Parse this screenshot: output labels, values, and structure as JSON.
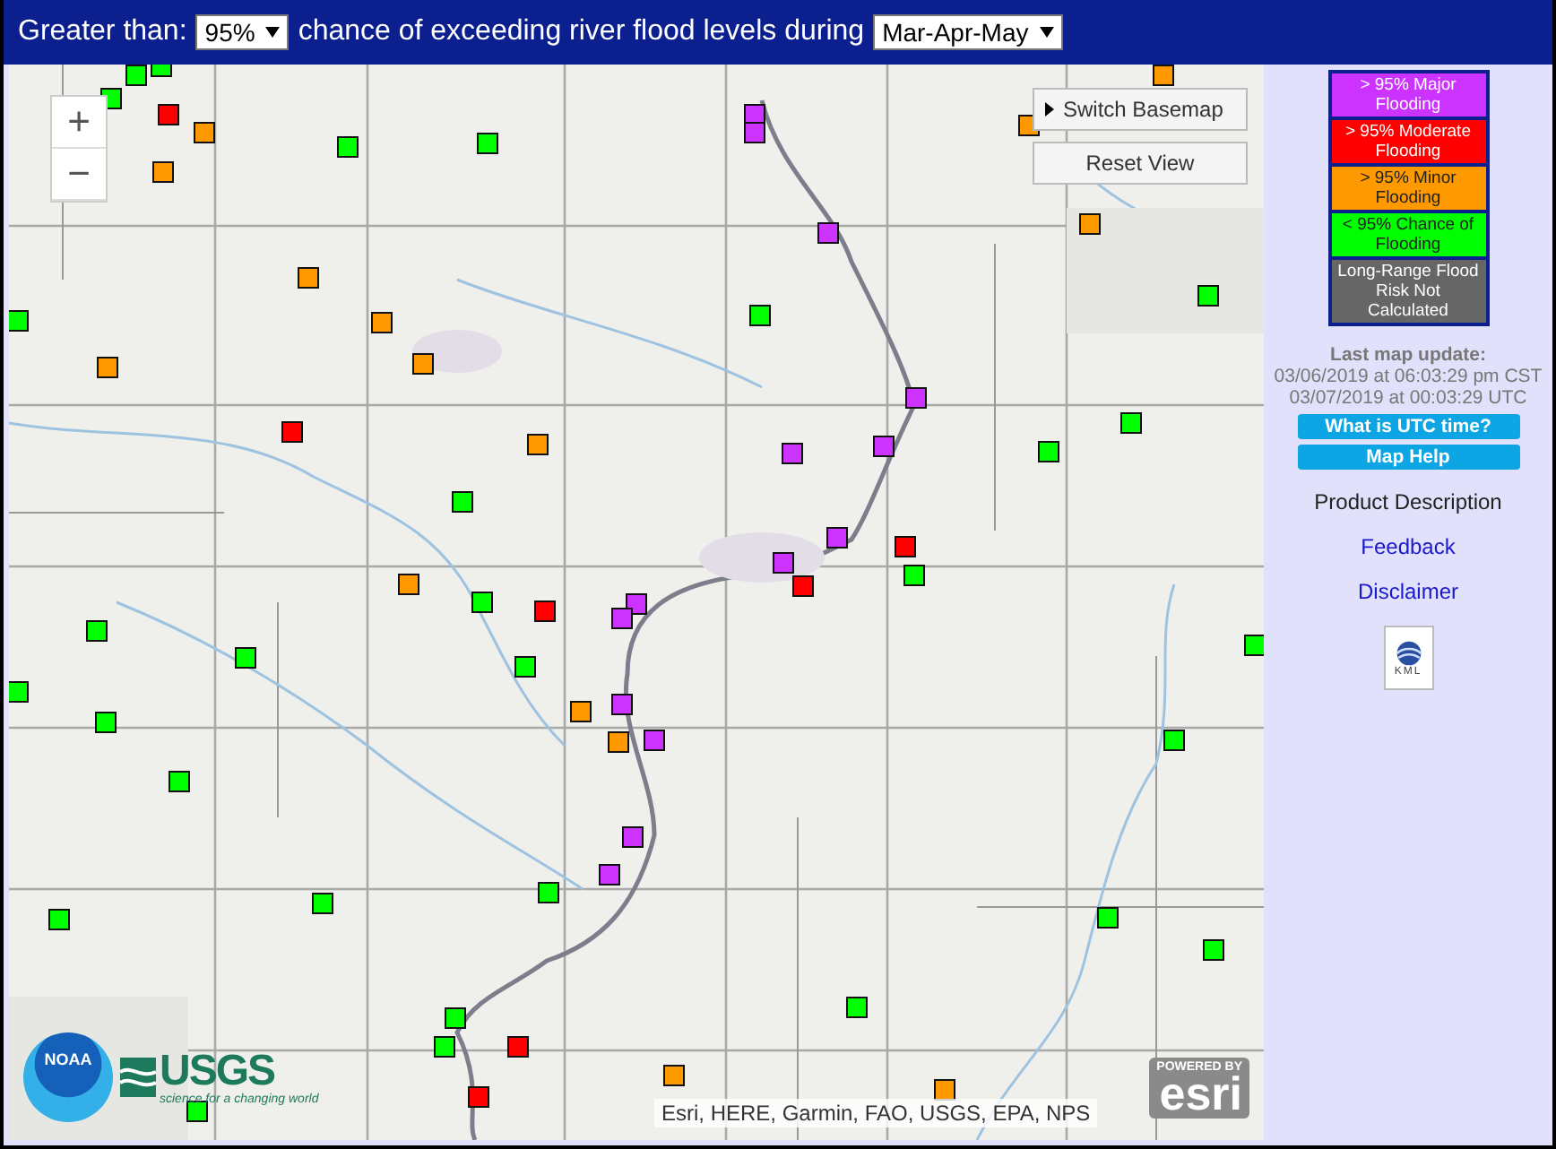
{
  "header": {
    "label_before": "Greater than:",
    "threshold": "95%",
    "label_after": "chance of exceeding river flood levels during",
    "period": "Mar-Apr-May"
  },
  "map": {
    "zoom_in": "+",
    "zoom_out": "−",
    "switch_basemap": "Switch Basemap",
    "reset_view": "Reset View",
    "attribution": "Esri, HERE, Garmin, FAO, USGS, EPA, NPS",
    "logos": {
      "noaa": "NOAA",
      "usgs": "USGS",
      "usgs_tagline": "science for a changing world",
      "esri_top": "POWERED BY",
      "esri": "esri"
    },
    "markers": [
      {
        "color": "#00ff00"
      },
      {
        "color": "#00ff00"
      },
      {
        "color": "#00ff00"
      },
      {
        "color": "#ff0000"
      },
      {
        "color": "#ff9900"
      },
      {
        "color": "#00ff00"
      },
      {
        "color": "#ff9900"
      },
      {
        "color": "#00ff00"
      },
      {
        "color": "#cc33ff"
      },
      {
        "color": "#cc33ff"
      },
      {
        "color": "#ff9900"
      },
      {
        "color": "#ff9900"
      },
      {
        "color": "#cc33ff"
      },
      {
        "color": "#ff9900"
      },
      {
        "color": "#00ff00"
      },
      {
        "color": "#ff9900"
      },
      {
        "color": "#ff9900"
      },
      {
        "color": "#00ff00"
      },
      {
        "color": "#ff9900"
      },
      {
        "color": "#ff9900"
      },
      {
        "color": "#00ff00"
      },
      {
        "color": "#cc33ff"
      },
      {
        "color": "#00ff00"
      },
      {
        "color": "#ff0000"
      },
      {
        "color": "#ff9900"
      },
      {
        "color": "#cc33ff"
      },
      {
        "color": "#cc33ff"
      },
      {
        "color": "#00ff00"
      },
      {
        "color": "#00ff00"
      },
      {
        "color": "#cc33ff"
      },
      {
        "color": "#cc33ff"
      },
      {
        "color": "#ff0000"
      },
      {
        "color": "#00ff00"
      },
      {
        "color": "#ff0000"
      },
      {
        "color": "#ff9900"
      },
      {
        "color": "#00ff00"
      },
      {
        "color": "#ff0000"
      },
      {
        "color": "#cc33ff"
      },
      {
        "color": "#cc33ff"
      },
      {
        "color": "#00ff00"
      },
      {
        "color": "#00ff00"
      },
      {
        "color": "#00ff00"
      },
      {
        "color": "#00ff00"
      },
      {
        "color": "#00ff00"
      },
      {
        "color": "#ff9900"
      },
      {
        "color": "#cc33ff"
      },
      {
        "color": "#ff9900"
      },
      {
        "color": "#cc33ff"
      },
      {
        "color": "#00ff00"
      },
      {
        "color": "#00ff00"
      },
      {
        "color": "#00ff00"
      },
      {
        "color": "#cc33ff"
      },
      {
        "color": "#cc33ff"
      },
      {
        "color": "#00ff00"
      },
      {
        "color": "#00ff00"
      },
      {
        "color": "#00ff00"
      },
      {
        "color": "#00ff00"
      },
      {
        "color": "#00ff00"
      },
      {
        "color": "#00ff00"
      },
      {
        "color": "#00ff00"
      },
      {
        "color": "#ff0000"
      },
      {
        "color": "#ff0000"
      },
      {
        "color": "#ff9900"
      },
      {
        "color": "#00ff00"
      },
      {
        "color": "#ff9900"
      },
      {
        "color": "#00ff00"
      }
    ]
  },
  "legend": [
    {
      "label": "> 95% Major Flooding",
      "color": "#cc33ff"
    },
    {
      "label": "> 95% Moderate Flooding",
      "color": "#ff0000"
    },
    {
      "label": "> 95% Minor Flooding",
      "color": "#ff9900"
    },
    {
      "label": "< 95% Chance of Flooding",
      "color": "#00ff00"
    },
    {
      "label": "Long-Range Flood Risk Not Calculated",
      "color": "#666666"
    }
  ],
  "last_update": {
    "title": "Last map update:",
    "local": "03/06/2019 at 06:03:29 pm CST",
    "utc": "03/07/2019 at 00:03:29 UTC"
  },
  "buttons": [
    "What is UTC time?",
    "Map Help"
  ],
  "links": [
    {
      "label": "Product Description",
      "kind": "plain"
    },
    {
      "label": "Feedback",
      "kind": "link"
    },
    {
      "label": "Disclaimer",
      "kind": "link"
    }
  ],
  "kml_label": "KML"
}
